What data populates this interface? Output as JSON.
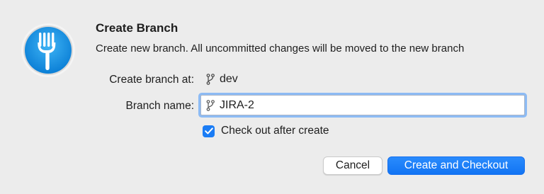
{
  "dialog": {
    "title": "Create Branch",
    "subtitle": "Create new branch. All uncommitted changes will be moved to the new branch",
    "app_icon": "fork-app-icon"
  },
  "form": {
    "create_at_label": "Create branch at:",
    "create_at_value": "dev",
    "branch_name_label": "Branch name:",
    "branch_name_value": "JIRA-2",
    "branch_icon": "git-branch-icon",
    "checkout_label": "Check out after create",
    "checkout_checked": true
  },
  "buttons": {
    "cancel_label": "Cancel",
    "primary_label": "Create and Checkout"
  },
  "colors": {
    "accent": "#1a7cf5",
    "background": "#ececec"
  }
}
